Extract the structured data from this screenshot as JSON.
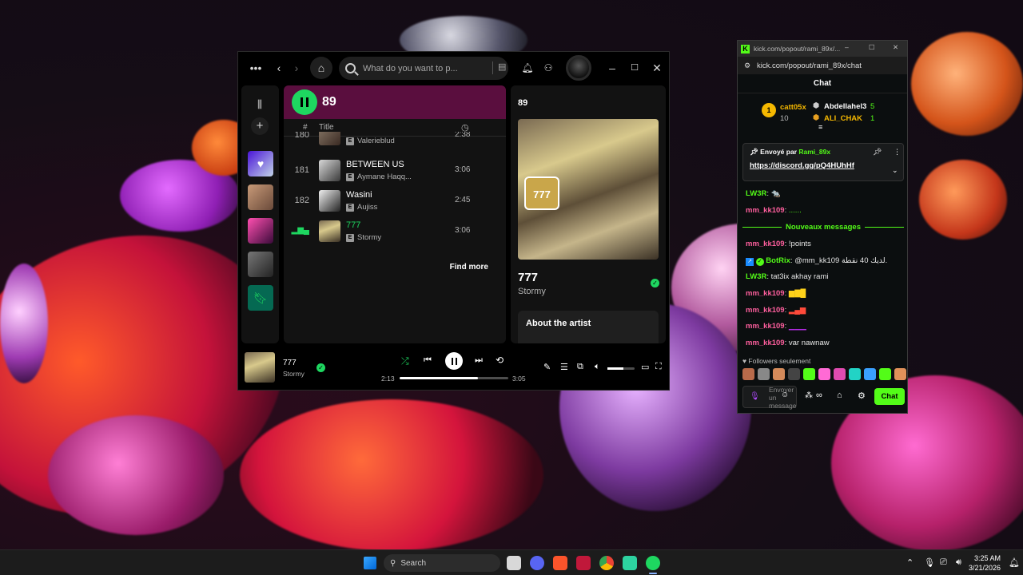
{
  "spotify": {
    "search_placeholder": "What do you want to p...",
    "playlist_title": "89",
    "columns": {
      "hash": "#",
      "title": "Title"
    },
    "tracks": [
      {
        "num": "180",
        "name": "",
        "artist": "Valerieblud",
        "duration": "2:38",
        "explicit": "E"
      },
      {
        "num": "181",
        "name": "BETWEEN US",
        "artist": "Aymane Haqq...",
        "duration": "3:06",
        "explicit": "E"
      },
      {
        "num": "182",
        "name": "Wasini",
        "artist": "Aujiss",
        "duration": "2:45",
        "explicit": "E"
      },
      {
        "num": "",
        "name": "777",
        "artist": "Stormy",
        "duration": "3:06",
        "explicit": "E"
      }
    ],
    "find_more": "Find more",
    "right_panel_title": "89",
    "now_title": "777",
    "now_artist": "Stormy",
    "about_label": "About the artist",
    "player": {
      "title": "777",
      "artist": "Stormy",
      "elapsed": "2:13",
      "total": "3:05",
      "progress": 0.72,
      "volume": 0.6
    }
  },
  "kick": {
    "tab_title": "kick.com/popout/rami_89x/...",
    "url": "kick.com/popout/rami_89x/chat",
    "header": "Chat",
    "leaderboard": [
      {
        "rank": "1",
        "user": "catt05x",
        "count": "10"
      },
      {
        "user": "Abdellahel3",
        "count": "5"
      },
      {
        "user": "ALI_CHAK",
        "count": "1"
      }
    ],
    "pinned": {
      "prefix": "Envoyé par",
      "by": "Rami_89x",
      "link": "https://discord.gg/pQ4HUhHf"
    },
    "messages": [
      {
        "user": "LW3R",
        "text": ""
      },
      {
        "user": "mm_kk109",
        "text": ""
      }
    ],
    "new_divider": "Nouveaux messages",
    "new_messages": [
      {
        "user": "mm_kk109",
        "text": "!points",
        "color": "pink"
      },
      {
        "user": "BotRix",
        "text": "@mm_kk109 لديك 40 نقطة.",
        "color": "green"
      },
      {
        "user": "LW3R",
        "text": "tat3ix akhay rami",
        "color": "green"
      },
      {
        "user": "mm_kk109",
        "text": "",
        "color": "pink"
      },
      {
        "user": "mm_kk109",
        "text": "",
        "color": "pink"
      },
      {
        "user": "mm_kk109",
        "text": "",
        "color": "pink"
      },
      {
        "user": "mm_kk109",
        "text": "var nawnaw",
        "color": "pink"
      }
    ],
    "followers_only": "Followers seulement",
    "input_placeholder": "Envoyer un message",
    "chat_button": "Chat"
  },
  "taskbar": {
    "search": "Search",
    "time": "3:25 AM",
    "date": "3/21/2026"
  },
  "colors": {
    "spotify_green": "#1ed760",
    "kick_green": "#53fc18",
    "playlist_header": "#5a0e3e"
  }
}
